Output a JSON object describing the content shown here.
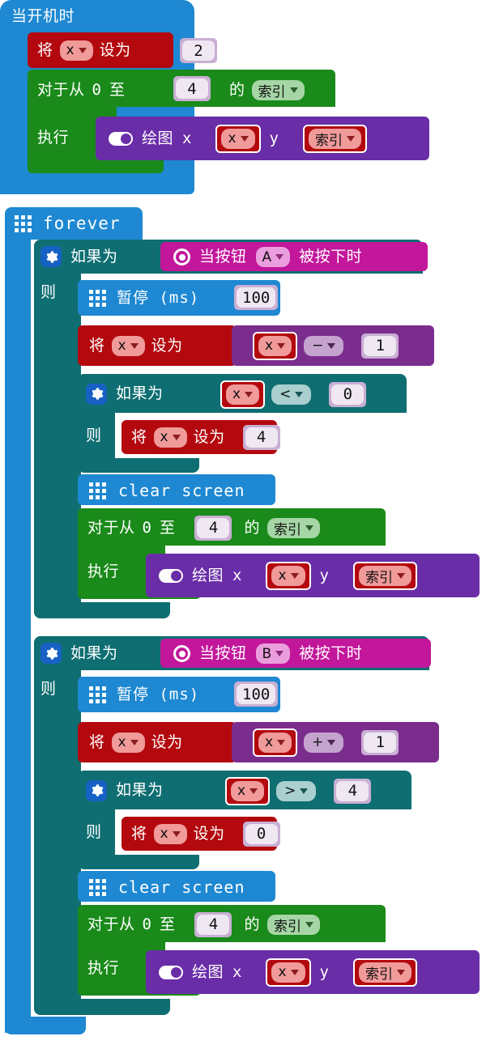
{
  "colors": {
    "event_blue": "#1e88d2",
    "loop_green": "#1a8a1a",
    "variable_red": "#b3080e",
    "logic_teal": "#0f6e72",
    "basic_blue": "#1e88d2",
    "led_purple": "#6a2da8",
    "math_purple": "#7b2d8e",
    "input_magenta": "#c2179b",
    "compare_teal": "#a9cfcf",
    "field_value": "#efe7f2",
    "field_value_border": "#c9afd4",
    "var_field": "#f09a9a",
    "green_field": "#a6d6a6",
    "magenta_field": "#eb9edd"
  },
  "scripts": {
    "on_start": {
      "header_label": "当开机时",
      "set_variable": {
        "prefix": "将",
        "variable": "x",
        "suffix": "设为",
        "value": "2"
      },
      "for_loop": {
        "prefix": "对于从",
        "from": "0",
        "to_label": "至",
        "to_value": "4",
        "of_label": "的",
        "index_variable": "索引",
        "do_label": "执行",
        "plot": {
          "label": "绘图",
          "x_label": "x",
          "x_value": "x",
          "y_label": "y",
          "y_value": "索引",
          "icon": "toggle-icon"
        }
      }
    },
    "forever": {
      "header_label": "forever",
      "header_icon": "led-grid-icon",
      "branches": [
        {
          "if_label": "如果为",
          "then_label": "则",
          "gear_icon": "gear-icon",
          "condition": {
            "icon": "radio-icon",
            "prefix": "当按钮",
            "button": "A",
            "suffix": "被按下时"
          },
          "body": {
            "pause": {
              "icon": "led-grid-icon",
              "label": "暂停 (ms)",
              "value": "100"
            },
            "set_variable": {
              "prefix": "将",
              "variable": "x",
              "suffix": "设为",
              "expression": {
                "left": "x",
                "operator": "−",
                "right": "1"
              }
            },
            "inner_if": {
              "if_label": "如果为",
              "then_label": "则",
              "gear_icon": "gear-icon",
              "condition": {
                "left": "x",
                "operator": "<",
                "right": "0"
              },
              "set_variable": {
                "prefix": "将",
                "variable": "x",
                "suffix": "设为",
                "value": "4"
              }
            },
            "clear_screen": {
              "icon": "led-grid-icon",
              "label": "clear screen"
            },
            "for_loop": {
              "prefix": "对于从",
              "from": "0",
              "to_label": "至",
              "to_value": "4",
              "of_label": "的",
              "index_variable": "索引",
              "do_label": "执行",
              "plot": {
                "label": "绘图",
                "x_label": "x",
                "x_value": "x",
                "y_label": "y",
                "y_value": "索引",
                "icon": "toggle-icon"
              }
            }
          }
        },
        {
          "if_label": "如果为",
          "then_label": "则",
          "gear_icon": "gear-icon",
          "condition": {
            "icon": "radio-icon",
            "prefix": "当按钮",
            "button": "B",
            "suffix": "被按下时"
          },
          "body": {
            "pause": {
              "icon": "led-grid-icon",
              "label": "暂停 (ms)",
              "value": "100"
            },
            "set_variable": {
              "prefix": "将",
              "variable": "x",
              "suffix": "设为",
              "expression": {
                "left": "x",
                "operator": "+",
                "right": "1"
              }
            },
            "inner_if": {
              "if_label": "如果为",
              "then_label": "则",
              "gear_icon": "gear-icon",
              "condition": {
                "left": "x",
                "operator": ">",
                "right": "4"
              },
              "set_variable": {
                "prefix": "将",
                "variable": "x",
                "suffix": "设为",
                "value": "0"
              }
            },
            "clear_screen": {
              "icon": "led-grid-icon",
              "label": "clear screen"
            },
            "for_loop": {
              "prefix": "对于从",
              "from": "0",
              "to_label": "至",
              "to_value": "4",
              "of_label": "的",
              "index_variable": "索引",
              "do_label": "执行",
              "plot": {
                "label": "绘图",
                "x_label": "x",
                "x_value": "x",
                "y_label": "y",
                "y_value": "索引",
                "icon": "toggle-icon"
              }
            }
          }
        }
      ]
    }
  }
}
